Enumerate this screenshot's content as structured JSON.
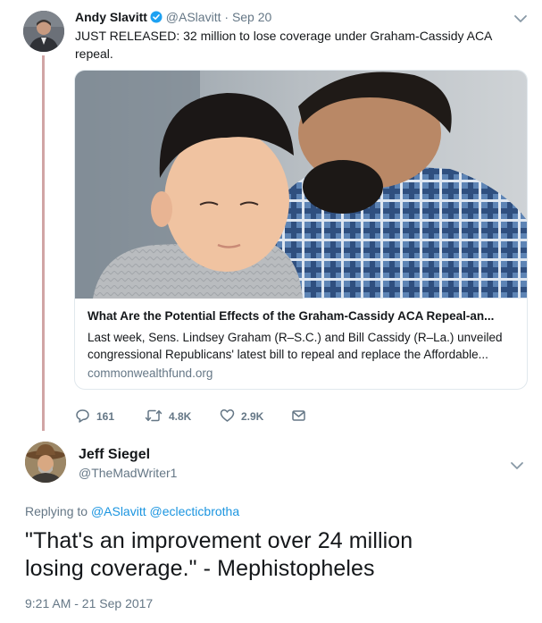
{
  "tweet1": {
    "author_name": "Andy Slavitt",
    "handle": "@ASlavitt",
    "separator": " · ",
    "date": "Sep 20",
    "text_line1": "JUST RELEASED: 32 million to lose coverage under Graham-Cassidy ACA",
    "text_line2": "repeal.",
    "card": {
      "title": "What Are the Potential Effects of the Graham-Cassidy ACA Repeal-an...",
      "description_line1": "Last week, Sens. Lindsey Graham (R–S.C.) and Bill Cassidy (R–La.) unveiled",
      "description_line2": "congressional Republicans' latest bill to repeal and replace the Affordable...",
      "domain": "commonwealthfund.org"
    },
    "actions": {
      "replies": "161",
      "retweets": "4.8K",
      "likes": "2.9K"
    }
  },
  "tweet2": {
    "author_name": "Jeff Siegel",
    "handle": "@TheMadWriter1",
    "replying_prefix": "Replying to ",
    "replying_to_1": "@ASlavitt",
    "replying_to_2": "@eclecticbrotha",
    "text_line1": "\"That's an improvement over 24 million",
    "text_line2": "losing coverage.\" - Mephistopheles",
    "timestamp": "9:21 AM - 21 Sep 2017"
  },
  "icons": {
    "verified": "verified-badge-icon",
    "reply": "reply-icon",
    "retweet": "retweet-icon",
    "like": "heart-icon",
    "dm": "envelope-icon",
    "more": "chevron-down-icon"
  },
  "colors": {
    "text": "#14171a",
    "muted": "#657786",
    "link": "#1b95e0",
    "verified": "#1da1f2",
    "thread_line": "#d1a5a5",
    "border": "#e1e8ed"
  }
}
